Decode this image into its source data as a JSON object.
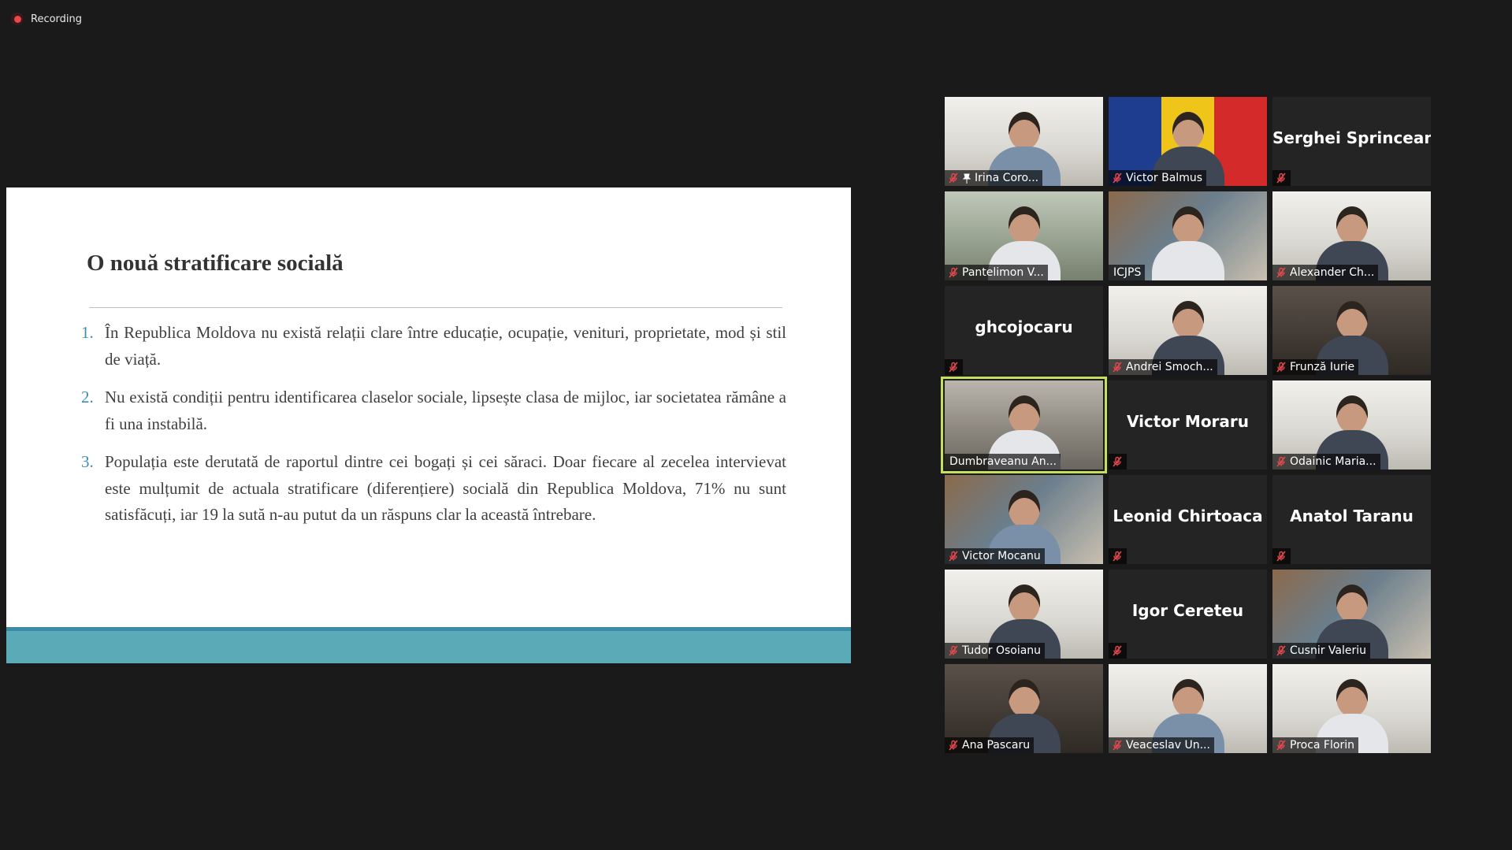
{
  "recording": {
    "label": "Recording",
    "icon": "record-dot-icon",
    "color": "#e5484d"
  },
  "slide": {
    "title": "O nouă stratificare socială",
    "items": [
      {
        "num": "1.",
        "text": "În Republica Moldova nu există relații clare între educație, ocupație, venituri, proprietate, mod și stil de viață."
      },
      {
        "num": "2.",
        "text": "Nu există condiții pentru identificarea claselor sociale, lipsește clasa de mijloc, iar societatea rămâne a fi una instabilă."
      },
      {
        "num": "3.",
        "text": "Populația este derutată de raportul dintre cei bogați și cei săraci. Doar fiecare al zecelea intervievat este mulțumit de actuala stratificare (diferențiere) socială din Republica Moldova, 71% nu sunt satisfăcuți, iar 19 la sută n-au putut da un răspuns clar la această întrebare."
      }
    ],
    "accent_color": "#5aaab8"
  },
  "participants": [
    {
      "name": "Irina Coro...",
      "video": true,
      "muted": true,
      "pinned": true,
      "active": false
    },
    {
      "name": "Victor Balmus",
      "video": true,
      "muted": true,
      "pinned": false,
      "active": false
    },
    {
      "name": "Serghei Sprincean",
      "video": false,
      "muted": true,
      "pinned": false,
      "active": false
    },
    {
      "name": "Pantelimon V...",
      "video": true,
      "muted": true,
      "pinned": false,
      "active": false
    },
    {
      "name": "ICJPS",
      "video": true,
      "muted": false,
      "pinned": false,
      "active": false
    },
    {
      "name": "Alexander Ch...",
      "video": true,
      "muted": true,
      "pinned": false,
      "active": false
    },
    {
      "name": "ghcojocaru",
      "video": false,
      "muted": true,
      "pinned": false,
      "active": false
    },
    {
      "name": "Andrei Smoch...",
      "video": true,
      "muted": true,
      "pinned": false,
      "active": false
    },
    {
      "name": "Frunză Iurie",
      "video": true,
      "muted": true,
      "pinned": false,
      "active": false
    },
    {
      "name": "Dumbraveanu An...",
      "video": true,
      "muted": false,
      "pinned": false,
      "active": true
    },
    {
      "name": "Victor Moraru",
      "video": false,
      "muted": true,
      "pinned": false,
      "active": false
    },
    {
      "name": "Odainic Maria...",
      "video": true,
      "muted": true,
      "pinned": false,
      "active": false
    },
    {
      "name": "Victor Mocanu",
      "video": true,
      "muted": true,
      "pinned": false,
      "active": false
    },
    {
      "name": "Leonid Chirtoaca",
      "video": false,
      "muted": true,
      "pinned": false,
      "active": false
    },
    {
      "name": "Anatol Taranu",
      "video": false,
      "muted": true,
      "pinned": false,
      "active": false
    },
    {
      "name": "Tudor Osoianu",
      "video": true,
      "muted": true,
      "pinned": false,
      "active": false
    },
    {
      "name": "Igor Cereteu",
      "video": false,
      "muted": true,
      "pinned": false,
      "active": false
    },
    {
      "name": "Cusnir Valeriu",
      "video": true,
      "muted": true,
      "pinned": false,
      "active": false
    },
    {
      "name": "Ana Pascaru",
      "video": true,
      "muted": true,
      "pinned": false,
      "active": false
    },
    {
      "name": "Veaceslav Un...",
      "video": true,
      "muted": true,
      "pinned": false,
      "active": false
    },
    {
      "name": "Proca Florin",
      "video": true,
      "muted": true,
      "pinned": false,
      "active": false
    }
  ],
  "colors": {
    "background": "#1a1a1a",
    "tile_background": "#242424",
    "active_speaker": "#c5e05a",
    "muted_icon": "#e5484d"
  }
}
